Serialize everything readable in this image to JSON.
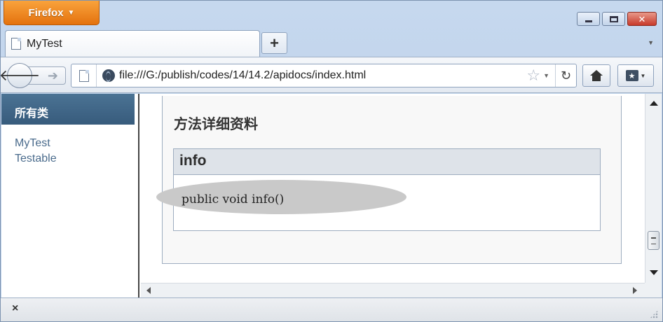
{
  "browser": {
    "menu_button_label": "Firefox",
    "tab_title": "MyTest",
    "new_tab_label": "+",
    "url": "file:///G:/publish/codes/14/14.2/apidocs/index.html"
  },
  "window_controls": {
    "minimize": "minimize-icon",
    "maximize": "maximize-icon",
    "close_glyph": "✕"
  },
  "left_frame": {
    "header": "所有类",
    "classes": [
      "MyTest",
      "Testable"
    ]
  },
  "right_frame": {
    "section_title": "方法详细资料",
    "method_name": "info",
    "method_signature": "public void info()"
  },
  "status_bar": {
    "close_glyph": "×"
  },
  "colors": {
    "firefox_orange": "#e4720e",
    "frame_header_blue": "#4b7394",
    "link_color": "#4a6b8c",
    "method_header_bg": "#dee3e9",
    "highlight_gray": "#c9c9c9"
  }
}
